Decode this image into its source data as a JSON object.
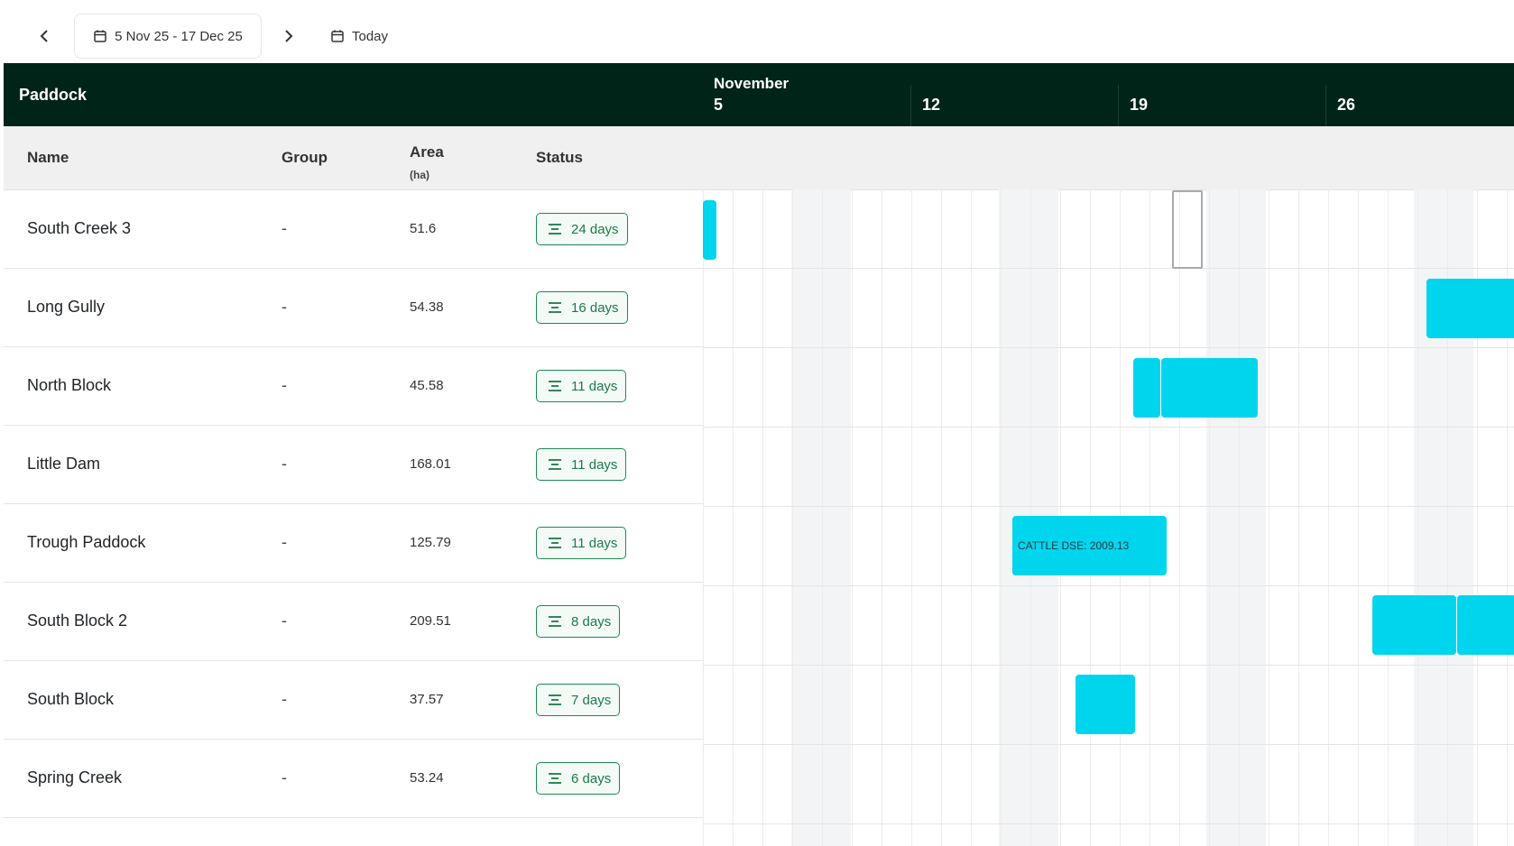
{
  "toolbar": {
    "date_range": "5 Nov 25 - 17 Dec 25",
    "today_label": "Today"
  },
  "table": {
    "section_title": "Paddock",
    "columns": {
      "name": "Name",
      "group": "Group",
      "area": "Area",
      "area_unit": "(ha)",
      "status": "Status"
    },
    "rows": [
      {
        "name": "South Creek 3",
        "group": "-",
        "area": "51.6",
        "status": "24 days"
      },
      {
        "name": "Long Gully",
        "group": "-",
        "area": "54.38",
        "status": "16 days"
      },
      {
        "name": "North Block",
        "group": "-",
        "area": "45.58",
        "status": "11 days"
      },
      {
        "name": "Little Dam",
        "group": "-",
        "area": "168.01",
        "status": "11 days"
      },
      {
        "name": "Trough Paddock",
        "group": "-",
        "area": "125.79",
        "status": "11 days"
      },
      {
        "name": "South Block 2",
        "group": "-",
        "area": "209.51",
        "status": "8 days"
      },
      {
        "name": "South Block",
        "group": "-",
        "area": "37.57",
        "status": "7 days"
      },
      {
        "name": "Spring Creek",
        "group": "-",
        "area": "53.24",
        "status": "6 days"
      }
    ]
  },
  "timeline": {
    "month_label": "November",
    "weeks": [
      "5",
      "12",
      "19",
      "26"
    ],
    "bar_color": "#00d5ee",
    "bar_labels": {
      "trough_paddock": "CATTLE DSE: 2009.13"
    }
  },
  "colors": {
    "header_dark": "#002418",
    "status_green": "#1c8a52",
    "bar_cyan": "#00d5ee"
  }
}
